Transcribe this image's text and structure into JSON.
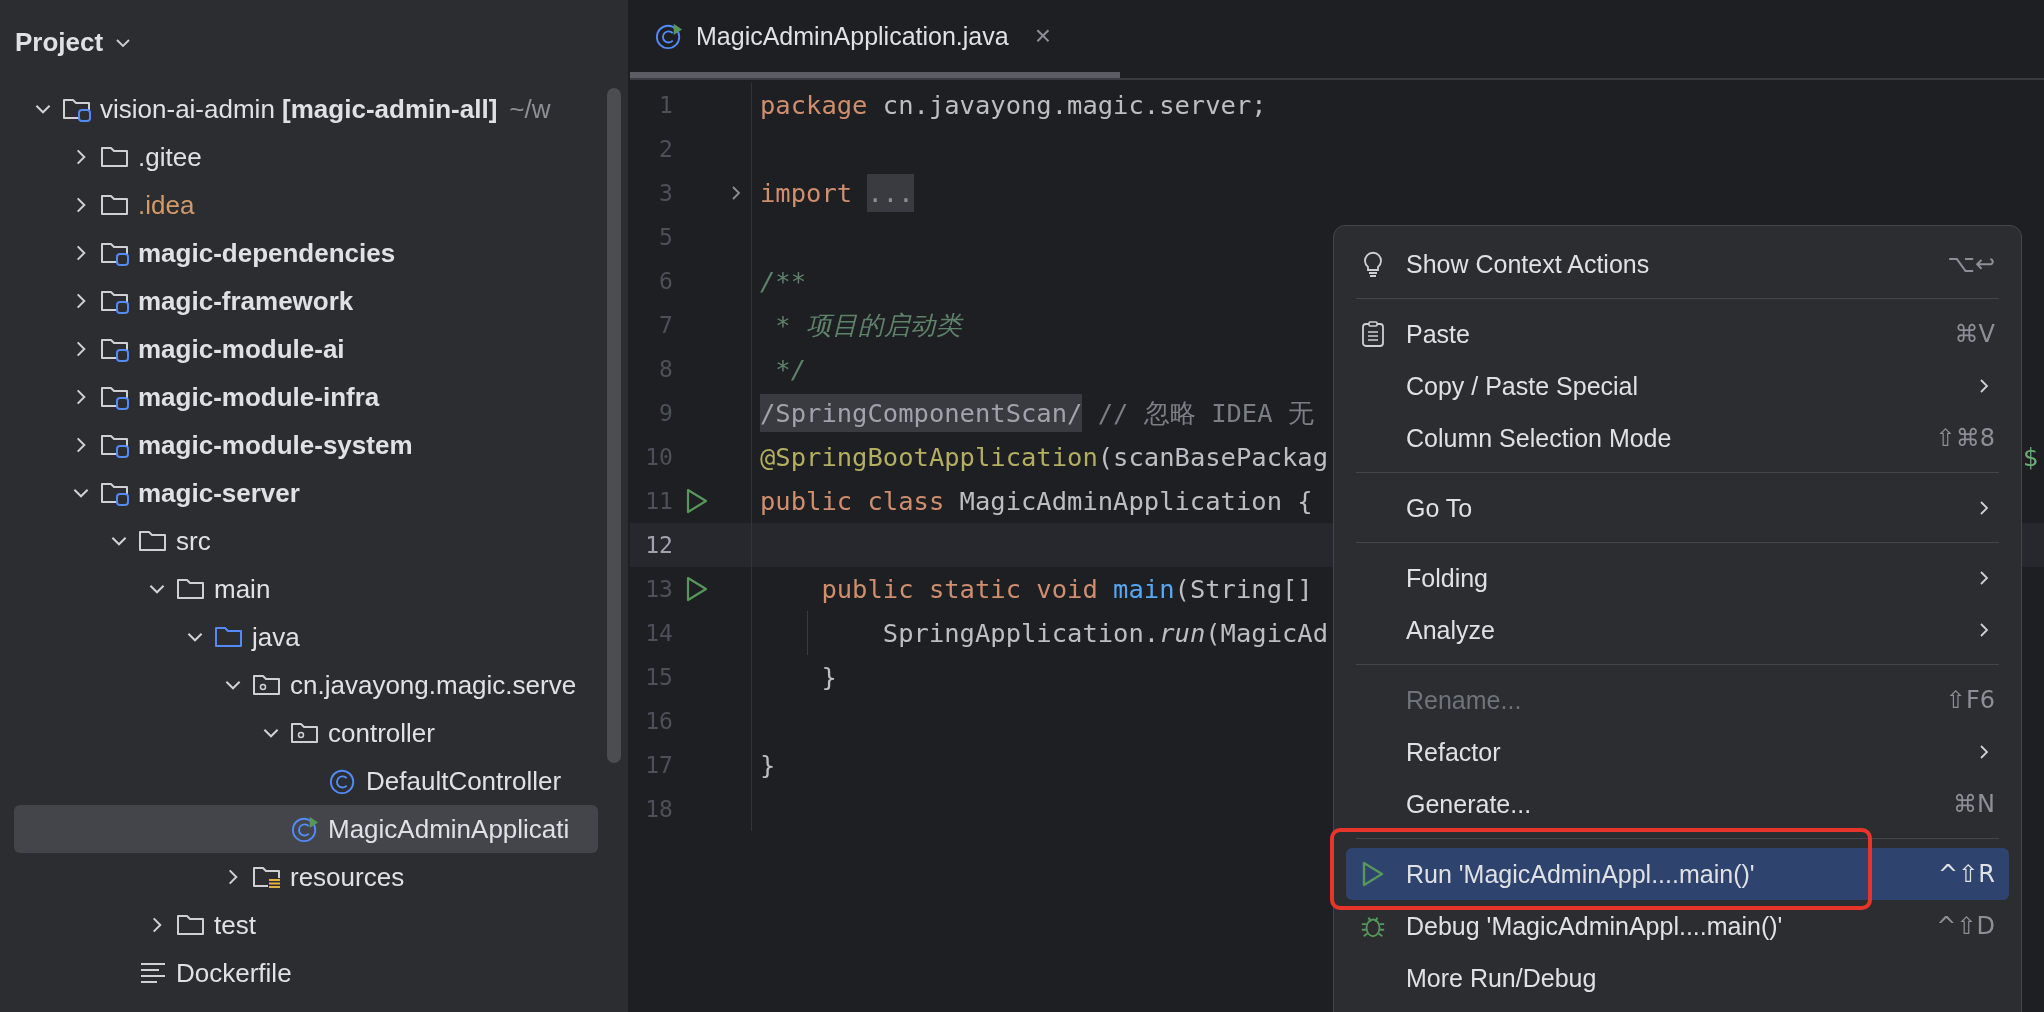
{
  "project_panel": {
    "title": "Project",
    "tree": [
      {
        "label": "vision-ai-admin **[magic-admin-all]**",
        "hint": "~/w",
        "kind": "module",
        "expanded": true,
        "selected": false,
        "children": [
          {
            "label": ".gitee",
            "kind": "folder",
            "expanded": false,
            "selected": false
          },
          {
            "label": ".idea",
            "kind": "folder",
            "expanded": false,
            "selected": false,
            "ignored": true
          },
          {
            "label": "**magic-dependencies**",
            "kind": "module",
            "expanded": false,
            "selected": false
          },
          {
            "label": "**magic-framework**",
            "kind": "module",
            "expanded": false,
            "selected": false
          },
          {
            "label": "**magic-module-ai**",
            "kind": "module",
            "expanded": false,
            "selected": false
          },
          {
            "label": "**magic-module-infra**",
            "kind": "module",
            "expanded": false,
            "selected": false
          },
          {
            "label": "**magic-module-system**",
            "kind": "module",
            "expanded": false,
            "selected": false
          },
          {
            "label": "**magic-server**",
            "kind": "module",
            "expanded": true,
            "selected": false,
            "children": [
              {
                "label": "src",
                "kind": "folder",
                "expanded": true,
                "selected": false,
                "children": [
                  {
                    "label": "main",
                    "kind": "folder",
                    "expanded": true,
                    "selected": false,
                    "children": [
                      {
                        "label": "java",
                        "kind": "source",
                        "expanded": true,
                        "selected": false,
                        "children": [
                          {
                            "label": "cn.javayong.magic.serve",
                            "kind": "package",
                            "expanded": true,
                            "selected": false,
                            "children": [
                              {
                                "label": "controller",
                                "kind": "package",
                                "expanded": true,
                                "selected": false,
                                "children": [
                                  {
                                    "label": "DefaultController",
                                    "kind": "class",
                                    "selected": false
                                  }
                                ]
                              },
                              {
                                "label": "MagicAdminApplicati",
                                "kind": "app-class",
                                "selected": true
                              }
                            ]
                          },
                          {
                            "label": "resources",
                            "kind": "resources",
                            "expanded": false,
                            "selected": false
                          }
                        ]
                      }
                    ]
                  },
                  {
                    "label": "test",
                    "kind": "folder",
                    "expanded": false,
                    "selected": false
                  }
                ]
              },
              {
                "label": "Dockerfile",
                "kind": "file",
                "selected": false
              }
            ]
          }
        ]
      }
    ]
  },
  "editor": {
    "tabs": [
      {
        "label": "MagicAdminApplication.java",
        "kind": "app-class",
        "selected": true,
        "close": "×"
      }
    ],
    "lines": [
      {
        "number": "1",
        "tokens": [
          {
            "text": "package",
            "kind": "keyword"
          },
          {
            "text": " cn.javayong.magic.server;",
            "kind": "plain"
          }
        ]
      },
      {
        "number": "2"
      },
      {
        "number": "3",
        "fold": true,
        "tokens": [
          {
            "text": "import ",
            "kind": "keyword"
          },
          {
            "text": "...",
            "kind": "folded"
          }
        ]
      },
      {
        "number": "5"
      },
      {
        "number": "6",
        "tokens": [
          {
            "text": "/**",
            "kind": "doc"
          }
        ]
      },
      {
        "number": "7",
        "tokens": [
          {
            "text": " * 项目的启动类",
            "kind": "doc"
          }
        ]
      },
      {
        "number": "8",
        "tokens": [
          {
            "text": " */",
            "kind": "doc"
          }
        ]
      },
      {
        "number": "9",
        "tokens": [
          {
            "text": "/SpringComponentScan/",
            "kind": "marked"
          },
          {
            "text": " // 忽略 IDEA 无",
            "kind": "comment"
          }
        ]
      },
      {
        "number": "10",
        "tokens": [
          {
            "text": "@SpringBootApplication",
            "kind": "annotation"
          },
          {
            "text": "(scanBasePackag",
            "kind": "plain"
          }
        ],
        "tail": "$"
      },
      {
        "number": "11",
        "run": true,
        "tokens": [
          {
            "text": "public class",
            "kind": "keyword"
          },
          {
            "text": " MagicAdminApplication {",
            "kind": "plain"
          }
        ]
      },
      {
        "number": "12",
        "current": true
      },
      {
        "number": "13",
        "run": true,
        "tokens": [
          {
            "text": "    public static void ",
            "kind": "keyword"
          },
          {
            "text": "main",
            "kind": "method"
          },
          {
            "text": "(String[]",
            "kind": "plain"
          }
        ]
      },
      {
        "number": "14",
        "guide": true,
        "tokens": [
          {
            "text": "        SpringApplication.",
            "kind": "plain"
          },
          {
            "text": "run",
            "kind": "static-call"
          },
          {
            "text": "(MagicAd",
            "kind": "plain"
          }
        ]
      },
      {
        "number": "15",
        "tokens": [
          {
            "text": "    }",
            "kind": "plain"
          }
        ]
      },
      {
        "number": "16"
      },
      {
        "number": "17",
        "tokens": [
          {
            "text": "}",
            "kind": "plain"
          }
        ]
      },
      {
        "number": "18"
      }
    ]
  },
  "context_menu": {
    "groups": [
      [
        {
          "label": "Show Context Actions",
          "kind": "context-actions",
          "shortcut": "⌥↩",
          "submenu": false,
          "disabled": false,
          "selected": false
        }
      ],
      [
        {
          "label": "Paste",
          "kind": "paste",
          "shortcut": "⌘V",
          "submenu": false,
          "disabled": false,
          "selected": false
        },
        {
          "label": "Copy / Paste Special",
          "submenu": true,
          "disabled": false,
          "selected": false
        },
        {
          "label": "Column Selection Mode",
          "shortcut": "⇧⌘8",
          "submenu": false,
          "disabled": false,
          "selected": false
        }
      ],
      [
        {
          "label": "Go To",
          "submenu": true,
          "disabled": false,
          "selected": false
        }
      ],
      [
        {
          "label": "Folding",
          "submenu": true,
          "disabled": false,
          "selected": false
        },
        {
          "label": "Analyze",
          "submenu": true,
          "disabled": false,
          "selected": false
        }
      ],
      [
        {
          "label": "Rename...",
          "shortcut": "⇧F6",
          "submenu": false,
          "disabled": true,
          "selected": false
        },
        {
          "label": "Refactor",
          "submenu": true,
          "disabled": false,
          "selected": false
        },
        {
          "label": "Generate...",
          "shortcut": "⌘N",
          "submenu": false,
          "disabled": false,
          "selected": false
        }
      ],
      [
        {
          "label": "Run 'MagicAdminAppl....main()'",
          "kind": "run",
          "shortcut": "^⇧R",
          "submenu": false,
          "disabled": false,
          "selected": true,
          "annotated": true
        },
        {
          "label": "Debug 'MagicAdminAppl....main()'",
          "kind": "debug",
          "shortcut": "^⇧D",
          "submenu": false,
          "disabled": false,
          "selected": false
        },
        {
          "label": "More Run/Debug",
          "submenu": false,
          "disabled": false,
          "selected": false
        }
      ]
    ]
  }
}
